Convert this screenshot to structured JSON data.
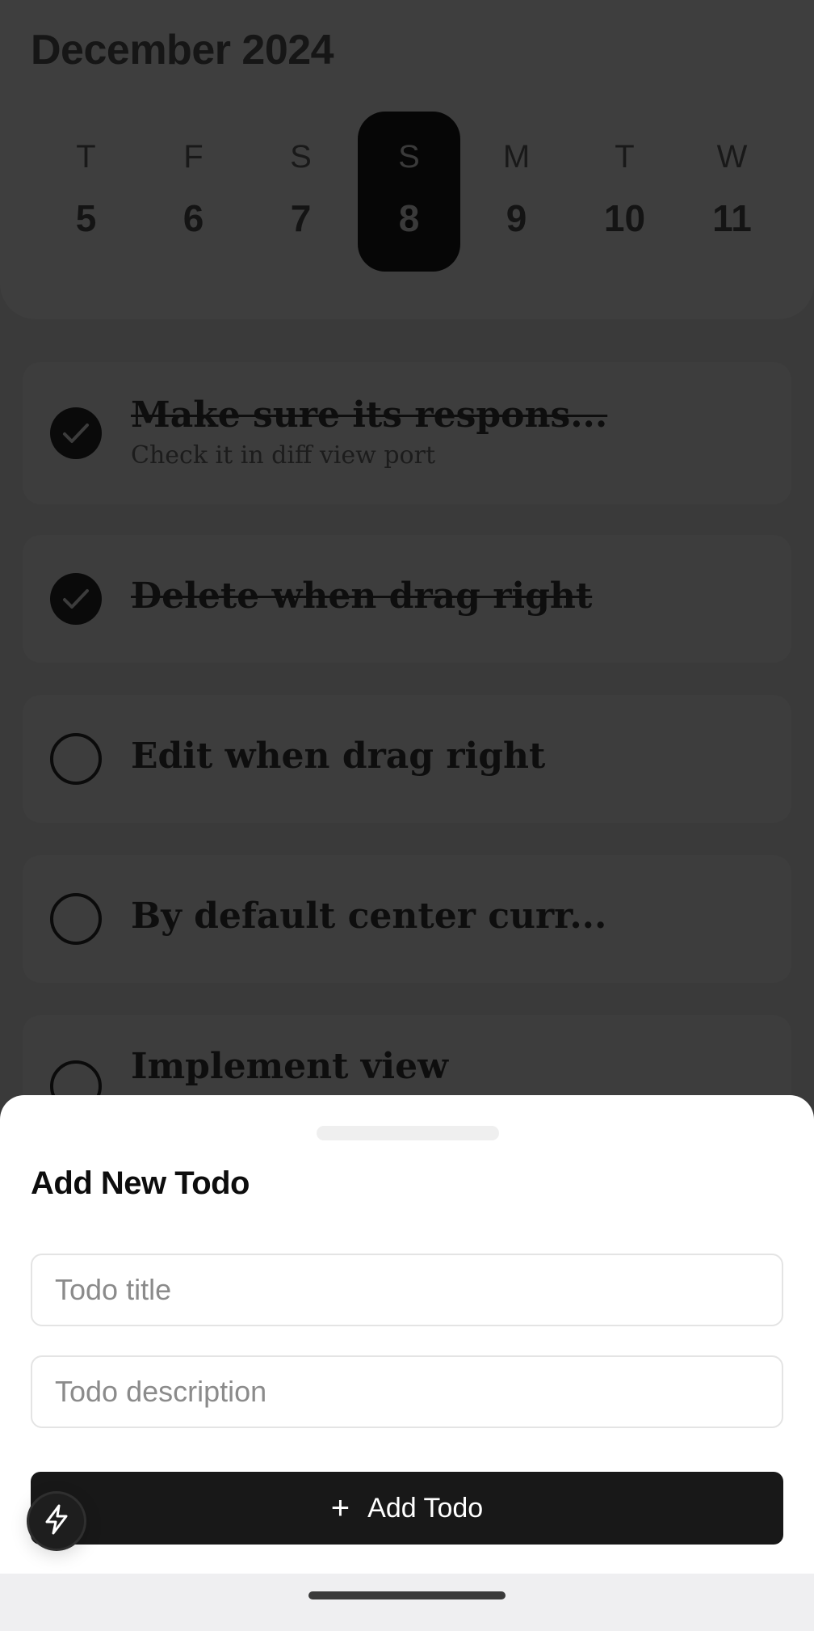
{
  "calendar": {
    "month_title": "December 2024",
    "days": [
      {
        "dow": "T",
        "num": "5"
      },
      {
        "dow": "F",
        "num": "6"
      },
      {
        "dow": "S",
        "num": "7"
      },
      {
        "dow": "S",
        "num": "8",
        "selected": true
      },
      {
        "dow": "M",
        "num": "9"
      },
      {
        "dow": "T",
        "num": "10"
      },
      {
        "dow": "W",
        "num": "11"
      }
    ]
  },
  "todos": [
    {
      "title": "Make sure its respons...",
      "description": "Check it in diff view port",
      "done": true
    },
    {
      "title": "Delete when drag right",
      "done": true
    },
    {
      "title": "Edit when drag right",
      "done": false
    },
    {
      "title": "By default center curr...",
      "done": false
    },
    {
      "title": "Implement view",
      "done": false
    }
  ],
  "sheet": {
    "title": "Add New Todo",
    "title_placeholder": "Todo title",
    "description_placeholder": "Todo description",
    "title_value": "",
    "description_value": "",
    "add_button_label": "Add Todo",
    "add_button_icon": "plus-icon"
  },
  "fab_icon": "lightning-icon",
  "colors": {
    "overlay": "#3a3a3a",
    "sheet_bg": "#ffffff",
    "primary_button": "#181818"
  }
}
